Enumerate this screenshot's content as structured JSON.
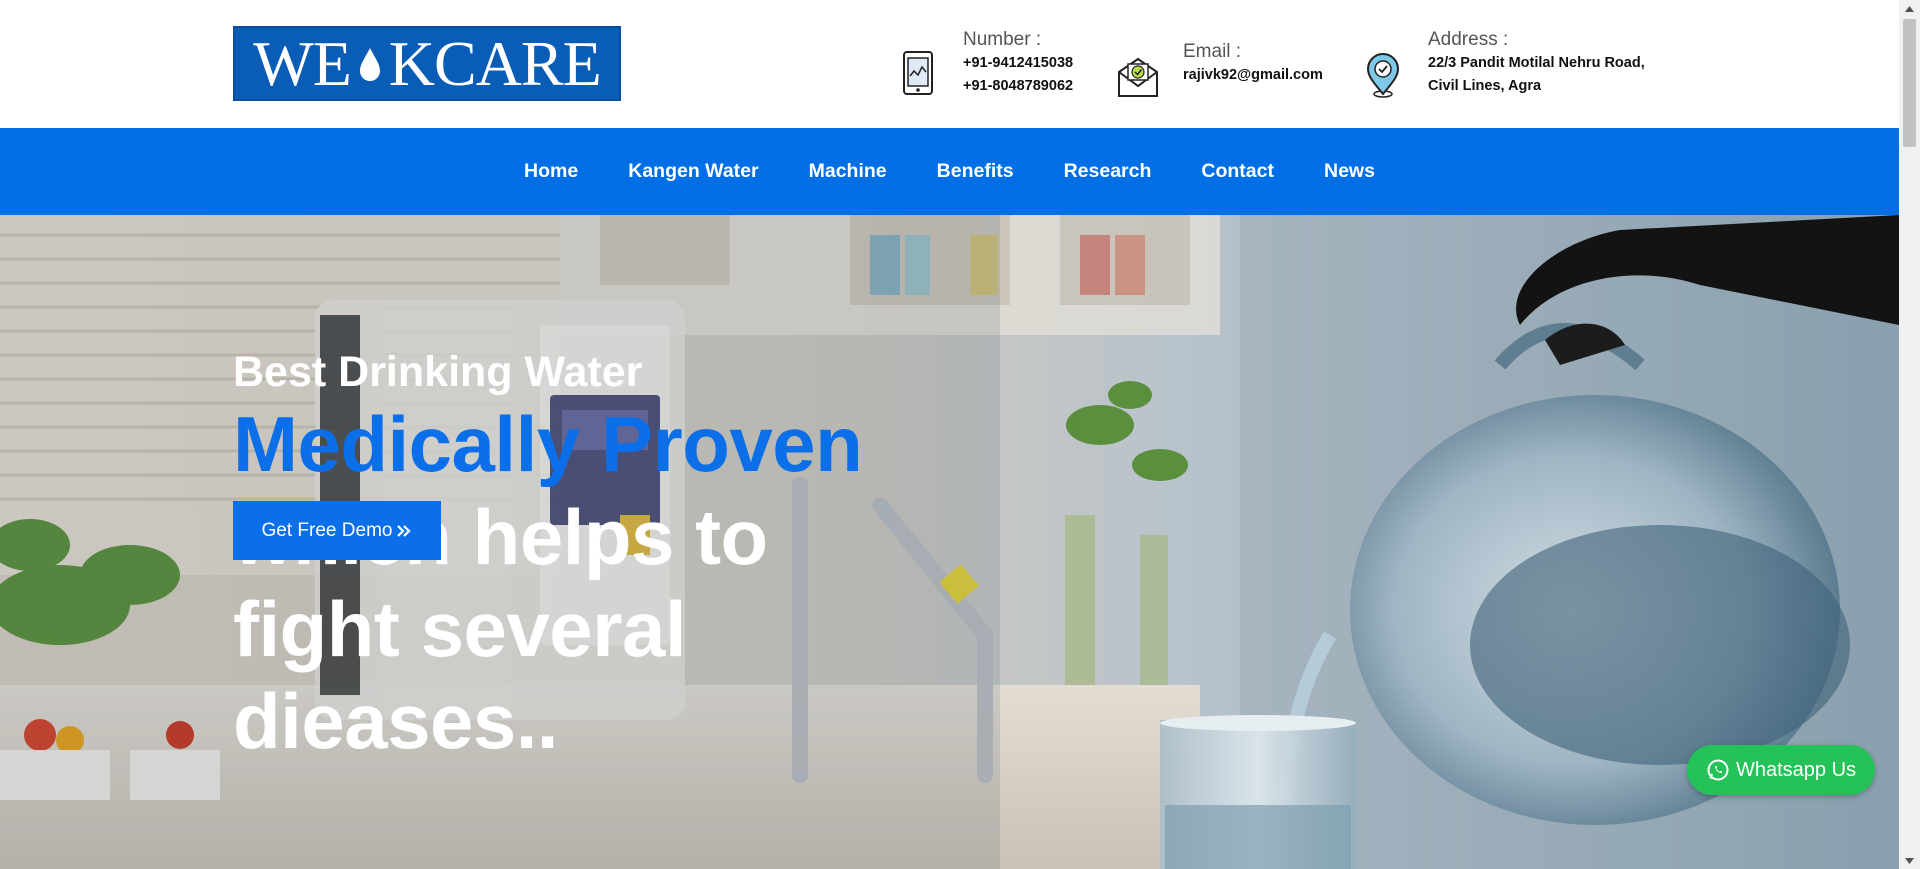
{
  "header": {
    "logo_text_left": "WE",
    "logo_text_right": "KCARE",
    "contacts": [
      {
        "label": "Number :",
        "lines": [
          "+91-9412415038",
          "+91-8048789062"
        ],
        "icon": "mobile-phone-icon"
      },
      {
        "label": "Email :",
        "lines": [
          "rajivk92@gmail.com"
        ],
        "icon": "envelope-icon"
      },
      {
        "label": "Address :",
        "lines": [
          "22/3 Pandit Motilal Nehru Road,",
          "Civil Lines, Agra"
        ],
        "icon": "location-pin-icon"
      }
    ]
  },
  "nav": {
    "items": [
      "Home",
      "Kangen Water",
      "Machine",
      "Benefits",
      "Research",
      "Contact",
      "News"
    ]
  },
  "hero": {
    "subtitle": "Best Drinking Water",
    "highlight": "Medically Proven",
    "headline": "which helps to fight several dieases..",
    "cta_label": "Get Free Demo",
    "cta_icon": "double-chevron-right-icon"
  },
  "whatsapp": {
    "label": "Whatsapp Us",
    "icon": "whatsapp-icon"
  },
  "colors": {
    "brand_blue": "#006fe6",
    "highlight_blue": "#0a6fe8",
    "whatsapp_green": "#25c25a",
    "logo_blue": "#0a5db7"
  }
}
